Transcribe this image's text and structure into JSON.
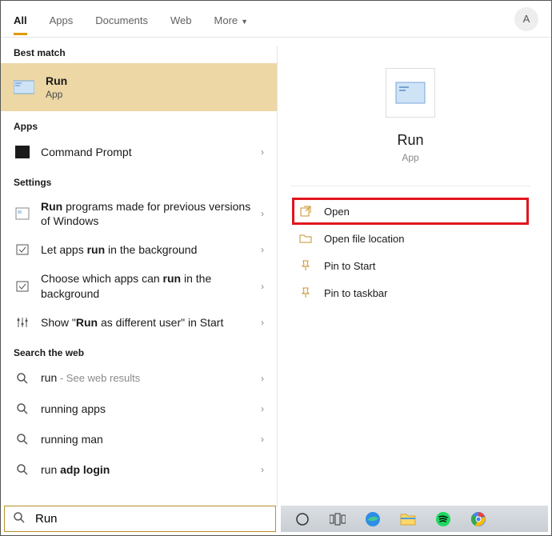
{
  "tabs": {
    "all": "All",
    "apps": "Apps",
    "documents": "Documents",
    "web": "Web",
    "more": "More"
  },
  "avatar_initial": "A",
  "sections": {
    "best_match": "Best match",
    "apps": "Apps",
    "settings": "Settings",
    "web": "Search the web"
  },
  "best_match": {
    "title": "Run",
    "subtitle": "App"
  },
  "apps_results": {
    "command_prompt": "Command Prompt"
  },
  "settings_results": {
    "run_previous_pre": " programs made for previous versions of Windows",
    "let_apps_pre": "Let apps ",
    "let_apps_post": " in the background",
    "choose_pre": "Choose which apps can ",
    "choose_post": " in the background",
    "show_pre": "Show \"",
    "show_mid": " as different user",
    "show_post": "\" in Start",
    "bold_run": "Run",
    "bold_run_lc": "run"
  },
  "web_results": {
    "r1_pre": "run",
    "r1_suffix": " - See web results",
    "r2": "running apps",
    "r3": "running man",
    "r4_pre": "run ",
    "r4_bold": "adp login"
  },
  "detail": {
    "title": "Run",
    "subtitle": "App",
    "actions": {
      "open": "Open",
      "open_file_location": "Open file location",
      "pin_start": "Pin to Start",
      "pin_taskbar": "Pin to taskbar"
    }
  },
  "search": {
    "value": "Run"
  }
}
